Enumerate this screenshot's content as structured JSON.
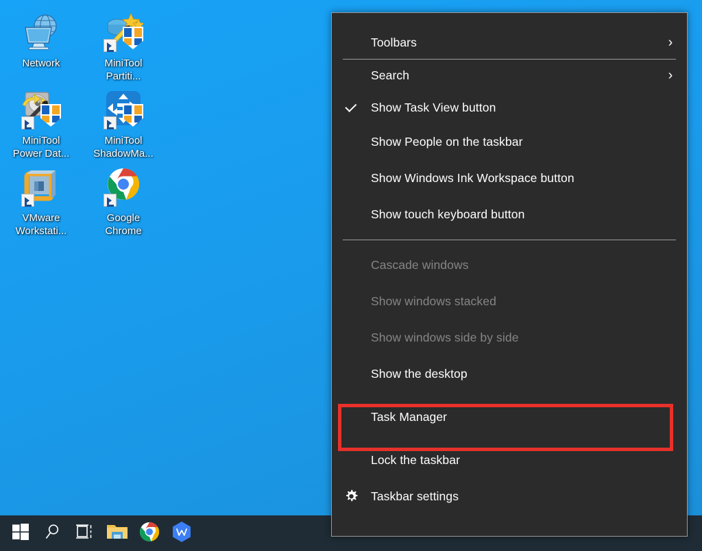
{
  "desktop": {
    "background_color": "#1b9bec",
    "icons": [
      {
        "label": "Network",
        "icon": "network-globe-monitor-icon",
        "shortcut": false
      },
      {
        "label": "MiniTool\nPartiti...",
        "icon": "minitool-partition-wizard-icon",
        "shortcut": true
      },
      {
        "label": "MiniTool\nPower Dat...",
        "icon": "minitool-power-data-recovery-icon",
        "shortcut": true
      },
      {
        "label": "MiniTool\nShadowMa...",
        "icon": "minitool-shadowmaker-icon",
        "shortcut": true
      },
      {
        "label": "VMware\nWorkstati...",
        "icon": "vmware-workstation-icon",
        "shortcut": true
      },
      {
        "label": "Google\nChrome",
        "icon": "google-chrome-icon",
        "shortcut": true
      }
    ]
  },
  "taskbar": {
    "background_color": "#1f2c35",
    "items": [
      {
        "name": "start-button",
        "icon": "windows-logo-icon"
      },
      {
        "name": "search-button",
        "icon": "search-magnifier-icon"
      },
      {
        "name": "task-view-button",
        "icon": "task-view-icon"
      },
      {
        "name": "file-explorer-button",
        "icon": "file-explorer-folder-icon"
      },
      {
        "name": "chrome-button",
        "icon": "google-chrome-icon"
      },
      {
        "name": "wps-office-button",
        "icon": "wps-office-icon"
      }
    ]
  },
  "context_menu": {
    "background_color": "#2b2b2b",
    "border_color": "#9a9a9a",
    "highlight_color": "#e8312a",
    "highlighted_item": "Task Manager",
    "items": [
      {
        "label": "Toolbars",
        "type": "submenu",
        "chevron": "›",
        "checked": false,
        "disabled": false,
        "icon": null
      },
      {
        "label": "Search",
        "type": "submenu",
        "chevron": "›",
        "checked": false,
        "disabled": false,
        "icon": null
      },
      {
        "label": "Show Task View button",
        "type": "checkbox",
        "checked": true,
        "disabled": false,
        "icon": "check-icon"
      },
      {
        "label": "Show People on the taskbar",
        "type": "checkbox",
        "checked": false,
        "disabled": false,
        "icon": null
      },
      {
        "label": "Show Windows Ink Workspace button",
        "type": "checkbox",
        "checked": false,
        "disabled": false,
        "icon": null
      },
      {
        "label": "Show touch keyboard button",
        "type": "checkbox",
        "checked": false,
        "disabled": false,
        "icon": null
      },
      {
        "label": "Cascade windows",
        "type": "command",
        "checked": false,
        "disabled": true,
        "icon": null
      },
      {
        "label": "Show windows stacked",
        "type": "command",
        "checked": false,
        "disabled": true,
        "icon": null
      },
      {
        "label": "Show windows side by side",
        "type": "command",
        "checked": false,
        "disabled": true,
        "icon": null
      },
      {
        "label": "Show the desktop",
        "type": "command",
        "checked": false,
        "disabled": false,
        "icon": null
      },
      {
        "label": "Task Manager",
        "type": "command",
        "checked": false,
        "disabled": false,
        "icon": null
      },
      {
        "label": "Lock the taskbar",
        "type": "checkbox",
        "checked": false,
        "disabled": false,
        "icon": null
      },
      {
        "label": "Taskbar settings",
        "type": "command",
        "checked": false,
        "disabled": false,
        "icon": "gear-icon"
      }
    ]
  }
}
